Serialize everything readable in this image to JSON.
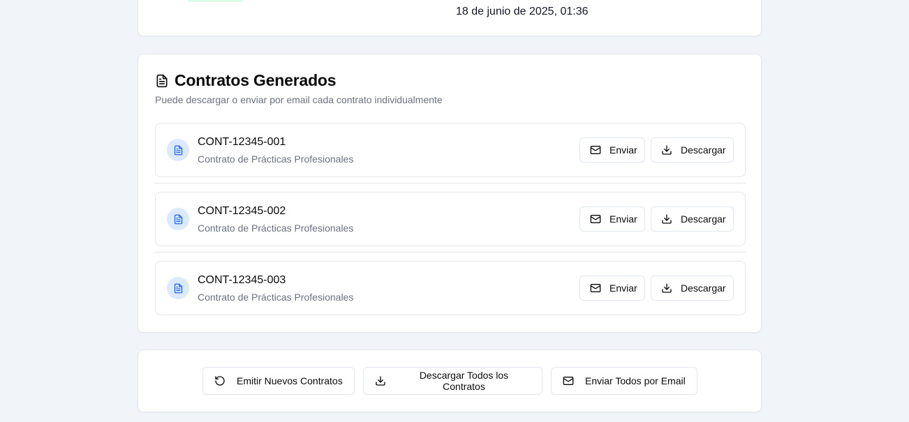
{
  "summary": {
    "date": "18 de junio de 2025, 01:36",
    "badge_color": "#dcfce7"
  },
  "contracts_section": {
    "icon": "file-text-icon",
    "title": "Contratos Generados",
    "subtitle": "Puede descargar o enviar por email cada contrato individualmente",
    "items": [
      {
        "code": "CONT-12345-001",
        "type": "Contrato de Prácticas Profesionales",
        "send_label": "Enviar",
        "download_label": "Descargar"
      },
      {
        "code": "CONT-12345-002",
        "type": "Contrato de Prácticas Profesionales",
        "send_label": "Enviar",
        "download_label": "Descargar"
      },
      {
        "code": "CONT-12345-003",
        "type": "Contrato de Prácticas Profesionales",
        "send_label": "Enviar",
        "download_label": "Descargar"
      }
    ]
  },
  "actions": {
    "reissue_label": "Emitir Nuevos Contratos",
    "download_all_label": "Descargar Todos los Contratos",
    "email_all_label": "Enviar Todos por Email"
  },
  "colors": {
    "page_bg": "#f1f4f9",
    "accent_blue": "#2563eb",
    "icon_circle": "#dbeafe",
    "muted_text": "#6b7280"
  }
}
